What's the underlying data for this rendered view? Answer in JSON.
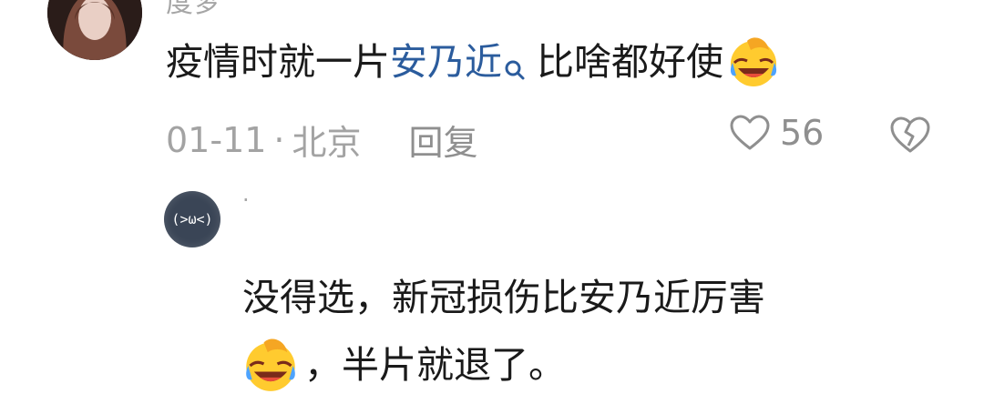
{
  "comment1": {
    "username": "度梦",
    "text_before": "疫情时就一片",
    "link_text": "安乃近",
    "text_after": "比啥都好使",
    "date": "01-11",
    "separator": "·",
    "location": "北京",
    "reply_label": "回复",
    "like_count": "56",
    "emoji": "laughing-crying-emoji"
  },
  "reply1": {
    "username": "·",
    "avatar_text": "(>ω<)",
    "line1": "没得选，新冠损伤比安乃近厉害",
    "line2": "，半片就退了。",
    "emoji": "laughing-crying-emoji"
  },
  "colors": {
    "link": "#2b5c9d",
    "meta": "#a3a3a3",
    "text": "#1a1a1a"
  }
}
